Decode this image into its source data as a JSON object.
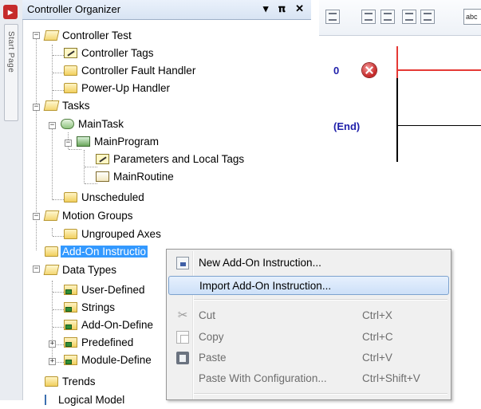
{
  "organizer": {
    "title": "Controller Organizer",
    "controls": "▾ &#x2D17; ✕",
    "controls_text": "▾ p ✕"
  },
  "left_strip": {
    "tab_label": "Start Page"
  },
  "tree": {
    "controller": "Controller Test",
    "controller_tags": "Controller Tags",
    "fault_handler": "Controller Fault Handler",
    "powerup_handler": "Power-Up Handler",
    "tasks": "Tasks",
    "main_task": "MainTask",
    "main_program": "MainProgram",
    "params": "Parameters and Local Tags",
    "main_routine": "MainRoutine",
    "unscheduled": "Unscheduled",
    "motion_groups": "Motion Groups",
    "ungrouped_axes": "Ungrouped Axes",
    "add_on": "Add-On Instructio",
    "data_types": "Data Types",
    "user_defined": "User-Defined",
    "strings": "Strings",
    "add_on_defined": "Add-On-Define",
    "predefined": "Predefined",
    "module_defined": "Module-Define",
    "trends": "Trends",
    "logical_model": "Logical Model"
  },
  "ladder": {
    "rung0": "0",
    "end": "(End)",
    "field_text": "abc"
  },
  "context_menu": {
    "items": [
      {
        "label": "New Add-On Instruction...",
        "shortcut": "",
        "icon": "new-addon-icon"
      },
      {
        "label": "Import Add-On Instruction...",
        "shortcut": "",
        "icon": ""
      },
      {
        "label": "Cut",
        "shortcut": "Ctrl+X",
        "icon": "cut-icon"
      },
      {
        "label": "Copy",
        "shortcut": "Ctrl+C",
        "icon": "copy-icon"
      },
      {
        "label": "Paste",
        "shortcut": "Ctrl+V",
        "icon": "paste-icon"
      },
      {
        "label": "Paste With Configuration...",
        "shortcut": "Ctrl+Shift+V",
        "icon": ""
      }
    ]
  }
}
